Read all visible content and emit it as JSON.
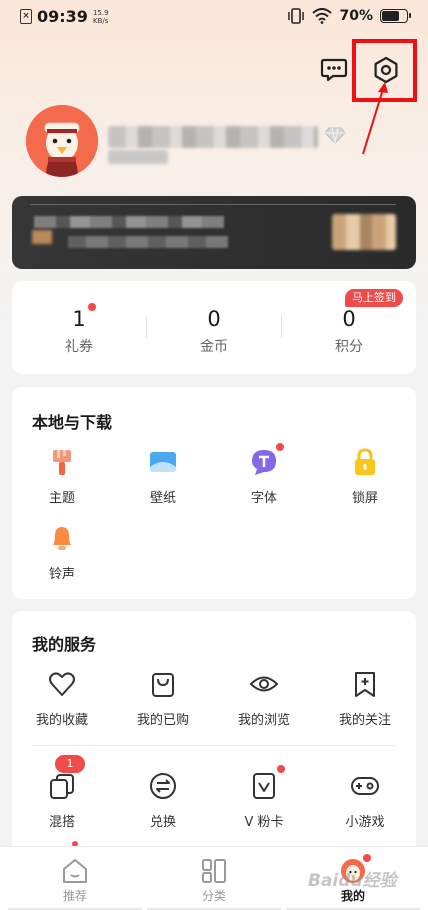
{
  "status_bar": {
    "time": "09:39",
    "net_speed_value": "15.9",
    "net_speed_unit": "KB/s",
    "battery_pct": "70%",
    "battery_level": 0.7
  },
  "stats": [
    {
      "value": "1",
      "label": "礼券",
      "has_dot": true
    },
    {
      "value": "0",
      "label": "金币",
      "has_dot": false
    },
    {
      "value": "0",
      "label": "积分",
      "has_dot": false
    }
  ],
  "signin_badge": "马上签到",
  "local": {
    "title": "本地与下载",
    "items": [
      {
        "label": "主题",
        "icon": "brush-icon"
      },
      {
        "label": "壁纸",
        "icon": "wallpaper-icon"
      },
      {
        "label": "字体",
        "icon": "font-icon",
        "has_dot": true
      },
      {
        "label": "锁屏",
        "icon": "lock-icon"
      },
      {
        "label": "铃声",
        "icon": "bell-icon"
      }
    ]
  },
  "services": {
    "title": "我的服务",
    "row1": [
      {
        "label": "我的收藏",
        "icon": "heart-icon"
      },
      {
        "label": "我的已购",
        "icon": "bag-icon"
      },
      {
        "label": "我的浏览",
        "icon": "eye-icon"
      },
      {
        "label": "我的关注",
        "icon": "bookmark-plus-icon"
      }
    ],
    "row2": [
      {
        "label": "混搭",
        "icon": "copy-icon",
        "badge": "1"
      },
      {
        "label": "兑换",
        "icon": "exchange-icon"
      },
      {
        "label": "V 粉卡",
        "icon": "vcard-icon",
        "has_dot": true
      },
      {
        "label": "小游戏",
        "icon": "gamepad-icon"
      }
    ]
  },
  "nav": [
    {
      "label": "推荐",
      "icon": "home-icon",
      "active": false
    },
    {
      "label": "分类",
      "icon": "category-icon",
      "active": false
    },
    {
      "label": "我的",
      "icon": "avatar-icon",
      "active": true
    }
  ],
  "colors": {
    "accent_red": "#ef4b4b",
    "highlight_red": "#ee1111",
    "vip_bg": "#2e2e2e"
  },
  "watermark": "Baidu经验"
}
